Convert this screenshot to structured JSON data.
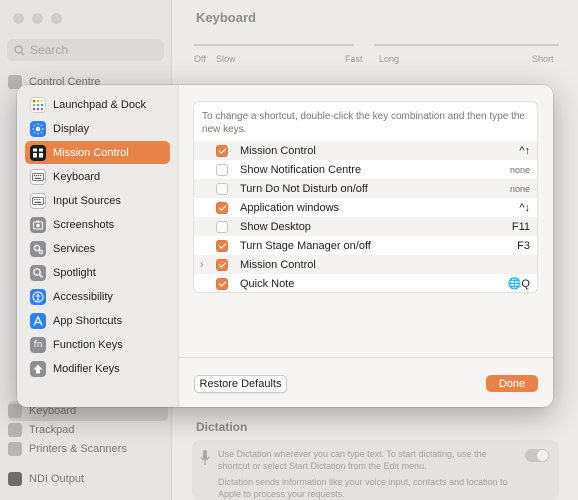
{
  "background": {
    "search_placeholder": "Search",
    "section_title": "Keyboard",
    "sidebar_items": [
      "Control Centre",
      "Keyboard",
      "Trackpad",
      "Printers & Scanners",
      "NDI Output"
    ],
    "repeat_labels": {
      "off": "Off",
      "slow": "Slow",
      "fast": "Fast"
    },
    "delay_labels": {
      "long": "Long",
      "short": "Short"
    },
    "dictation_title": "Dictation",
    "dictation_text_1": "Use Dictation wherever you can type text. To start dictating, use the shortcut or select Start Dictation from the Edit menu.",
    "dictation_text_2": "Dictation sends information like your voice input, contacts and location to Apple to process your requests."
  },
  "modal": {
    "categories": [
      {
        "label": "Launchpad & Dock",
        "icon": "launchpad-icon"
      },
      {
        "label": "Display",
        "icon": "display-icon"
      },
      {
        "label": "Mission Control",
        "icon": "mission-control-icon",
        "selected": true
      },
      {
        "label": "Keyboard",
        "icon": "keyboard-icon"
      },
      {
        "label": "Input Sources",
        "icon": "input-sources-icon"
      },
      {
        "label": "Screenshots",
        "icon": "screenshots-icon"
      },
      {
        "label": "Services",
        "icon": "services-icon"
      },
      {
        "label": "Spotlight",
        "icon": "spotlight-icon"
      },
      {
        "label": "Accessibility",
        "icon": "accessibility-icon"
      },
      {
        "label": "App Shortcuts",
        "icon": "app-shortcuts-icon"
      },
      {
        "label": "Function Keys",
        "icon": "function-keys-icon"
      },
      {
        "label": "Modifier Keys",
        "icon": "modifier-keys-icon"
      }
    ],
    "hint": "To change a shortcut, double-click the key combination and then type the new keys.",
    "shortcuts": [
      {
        "name": "Mission Control",
        "checked": true,
        "key": "^↑"
      },
      {
        "name": "Show Notification Centre",
        "checked": false,
        "key": "none"
      },
      {
        "name": "Turn Do Not Disturb on/off",
        "checked": false,
        "key": "none"
      },
      {
        "name": "Application windows",
        "checked": true,
        "key": "^↓"
      },
      {
        "name": "Show Desktop",
        "checked": false,
        "key": "F11"
      },
      {
        "name": "Turn Stage Manager on/off",
        "checked": true,
        "key": "F3"
      },
      {
        "name": "Mission Control",
        "checked": true,
        "key": "",
        "expandable": true
      },
      {
        "name": "Quick Note",
        "checked": true,
        "key": "🌐Q"
      }
    ],
    "restore_label": "Restore Defaults",
    "done_label": "Done"
  },
  "colors": {
    "accent": "#e8834a"
  }
}
